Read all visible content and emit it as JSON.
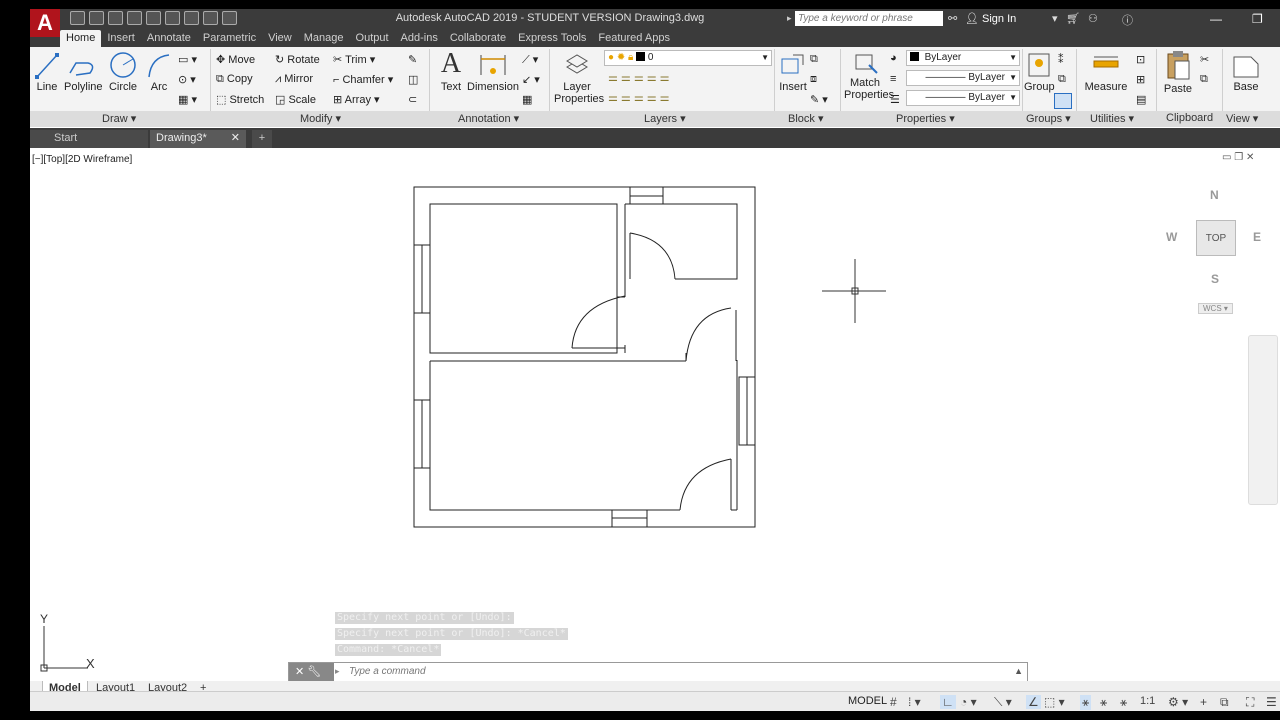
{
  "title": "Autodesk AutoCAD 2019 - STUDENT VERSION    Drawing3.dwg",
  "search_placeholder": "Type a keyword or phrase",
  "sign_in": "Sign In",
  "ribbon_tabs": [
    "Home",
    "Insert",
    "Annotate",
    "Parametric",
    "View",
    "Manage",
    "Output",
    "Add-ins",
    "Collaborate",
    "Express Tools",
    "Featured Apps"
  ],
  "draw": {
    "line": "Line",
    "polyline": "Polyline",
    "circle": "Circle",
    "arc": "Arc",
    "panel": "Draw ▾"
  },
  "modify": {
    "move": "Move",
    "rotate": "Rotate",
    "trim": "Trim",
    "copy": "Copy",
    "mirror": "Mirror",
    "chamfer": "Chamfer",
    "stretch": "Stretch",
    "scale": "Scale",
    "array": "Array",
    "panel": "Modify ▾"
  },
  "annotation": {
    "text": "Text",
    "dimension": "Dimension",
    "panel": "Annotation ▾"
  },
  "layers": {
    "layer_properties_1": "Layer",
    "layer_properties_2": "Properties",
    "current_layer": "0",
    "panel": "Layers ▾"
  },
  "block": {
    "insert": "Insert",
    "panel": "Block ▾"
  },
  "properties": {
    "match_1": "Match",
    "match_2": "Properties",
    "color": "ByLayer",
    "linetype": "ByLayer",
    "lineweight": "ByLayer",
    "panel": "Properties ▾"
  },
  "groups": {
    "group": "Group",
    "panel": "Groups ▾"
  },
  "utilities": {
    "measure": "Measure",
    "panel": "Utilities ▾"
  },
  "clipboard": {
    "paste": "Paste",
    "panel": "Clipboard"
  },
  "view": {
    "base": "Base",
    "panel": "View ▾"
  },
  "file_tabs": {
    "start": "Start",
    "drawing": "Drawing3*",
    "close": "✕",
    "add": "+"
  },
  "viewport_label": "[−][Top][2D Wireframe]",
  "viewcube": {
    "top": "TOP",
    "n": "N",
    "s": "S",
    "e": "E",
    "w": "W",
    "wcs": "WCS ▾"
  },
  "ucs": {
    "x": "X",
    "y": "Y"
  },
  "command_history": [
    "Specify next point or [Undo]:",
    "Specify next point or [Undo]: *Cancel*",
    "Command: *Cancel*"
  ],
  "command_placeholder": "Type a command",
  "layout_tabs": [
    "Model",
    "Layout1",
    "Layout2"
  ],
  "status": {
    "model": "MODEL",
    "scale": "1:1"
  }
}
